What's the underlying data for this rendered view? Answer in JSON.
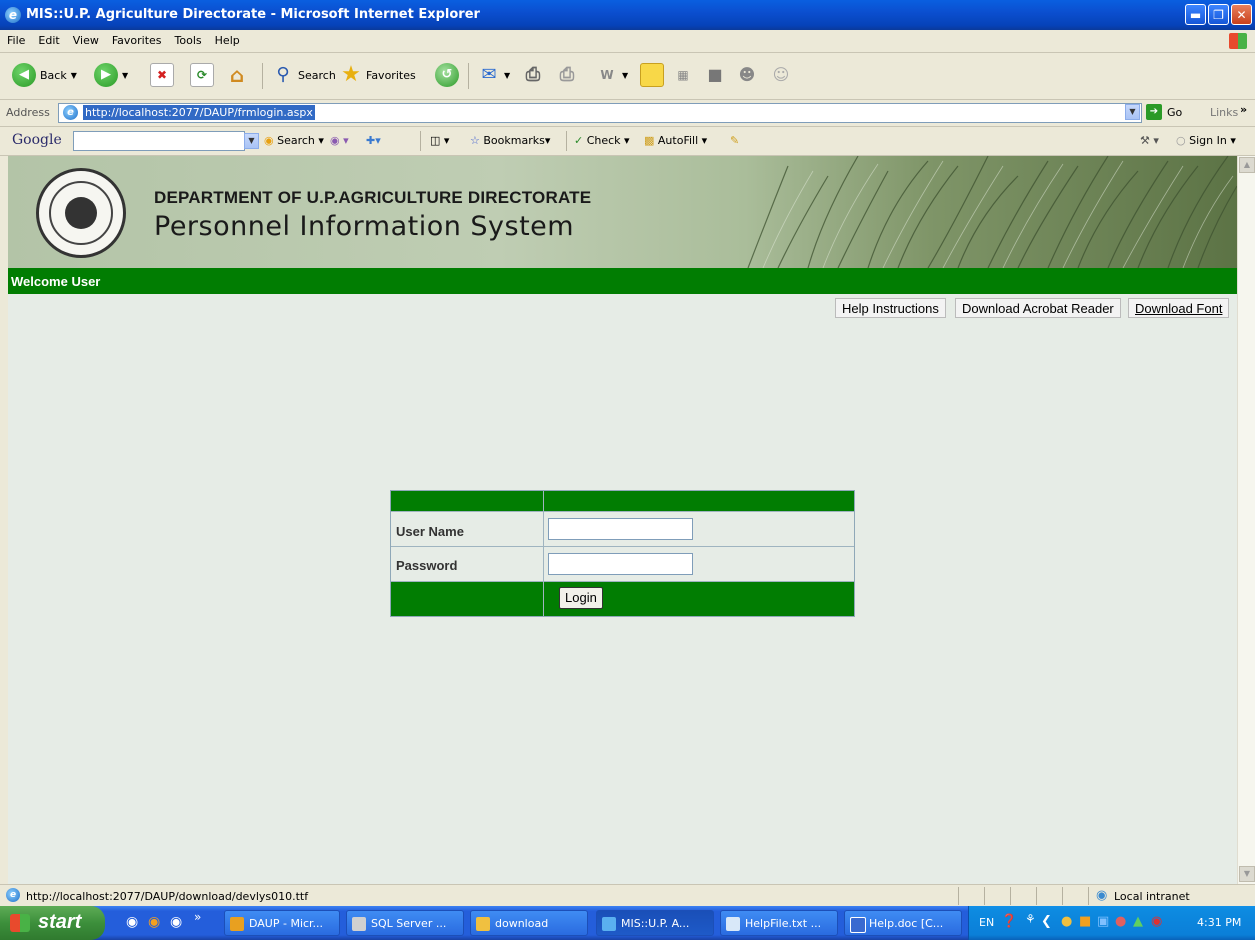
{
  "window": {
    "title": "MIS::U.P. Agriculture Directorate - Microsoft Internet Explorer"
  },
  "menu": [
    "File",
    "Edit",
    "View",
    "Favorites",
    "Tools",
    "Help"
  ],
  "toolbar": {
    "back": "Back",
    "search": "Search",
    "favorites": "Favorites"
  },
  "address": {
    "label": "Address",
    "url": "http://localhost:2077/DAUP/frmlogin.aspx",
    "go": "Go",
    "links": "Links"
  },
  "googlebar": {
    "logo": "Google",
    "search": "Search",
    "bookmarks": "Bookmarks",
    "check": "Check",
    "autofill": "AutoFill",
    "signin": "Sign In"
  },
  "page": {
    "dept_title": "DEPARTMENT OF U.P.AGRICULTURE DIRECTORATE",
    "system_title": "Personnel Information System",
    "welcome": "Welcome User",
    "links": {
      "help": "Help Instructions",
      "acrobat": "Download Acrobat Reader",
      "font": "Download Font"
    },
    "login": {
      "username_label": "User Name",
      "password_label": "Password",
      "username_value": "",
      "password_value": "",
      "button": "Login"
    }
  },
  "status": {
    "text": "http://localhost:2077/DAUP/download/devlys010.ttf",
    "zone": "Local intranet"
  },
  "taskbar": {
    "start": "start",
    "tasks": [
      "DAUP - Micr...",
      "SQL Server ...",
      "download",
      "MIS::U.P. A...",
      "HelpFile.txt ...",
      "Help.doc [C..."
    ],
    "lang": "EN",
    "clock": "4:31 PM"
  },
  "colors": {
    "green": "#017d02",
    "title_blue": "#0a5fe0",
    "taskbar_blue": "#245edb"
  }
}
